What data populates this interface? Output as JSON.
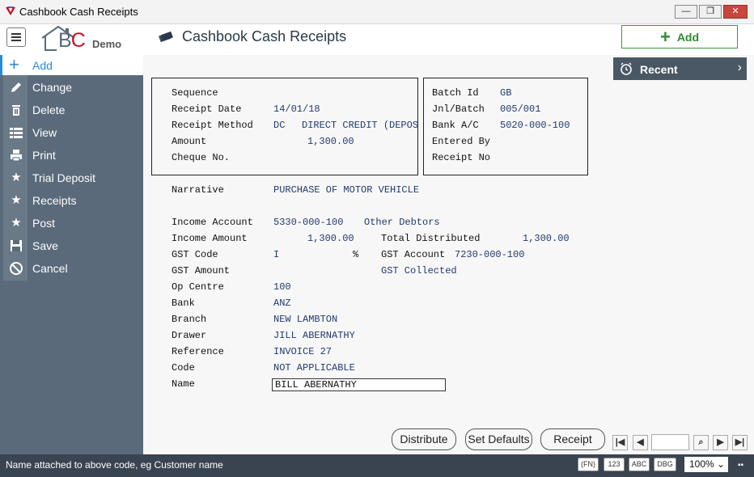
{
  "window": {
    "title": "Cashbook Cash Receipts",
    "min": "—",
    "restore": "❐",
    "close": "✕"
  },
  "header": {
    "logo_b": "B",
    "logo_c": "C",
    "logo_demo": "Demo",
    "page_title": "Cashbook Cash Receipts",
    "add_label": "Add",
    "plus": "+"
  },
  "sidebar": {
    "add": "Add",
    "items": [
      {
        "label": "Change",
        "icon": "pencil-icon"
      },
      {
        "label": "Delete",
        "icon": "trash-icon"
      },
      {
        "label": "View",
        "icon": "list-icon"
      },
      {
        "label": "Print",
        "icon": "printer-icon"
      },
      {
        "label": "Trial Deposit",
        "icon": "star-icon"
      },
      {
        "label": "Receipts",
        "icon": "star-icon"
      },
      {
        "label": "Post",
        "icon": "star-icon"
      },
      {
        "label": "Save",
        "icon": "floppy-icon"
      },
      {
        "label": "Cancel",
        "icon": "cancel-icon"
      }
    ]
  },
  "recent": {
    "label": "Recent",
    "chevron": "›"
  },
  "form": {
    "sequence_label": "Sequence",
    "receipt_date_label": "Receipt Date",
    "receipt_date": "14/01/18",
    "receipt_method_label": "Receipt Method",
    "receipt_method_code": "DC",
    "receipt_method_desc": "DIRECT CREDIT (DEPOS",
    "amount_label": "Amount",
    "amount": "1,300.00",
    "cheque_label": "Cheque No.",
    "batch_id_label": "Batch Id",
    "batch_id": "GB",
    "jnl_batch_label": "Jnl/Batch",
    "jnl_batch": "005/001",
    "bank_ac_label": "Bank A/C",
    "bank_ac": "5020-000-100",
    "entered_by_label": "Entered By",
    "receipt_no_label": "Receipt No",
    "narrative_label": "Narrative",
    "narrative": "PURCHASE OF MOTOR VEHICLE",
    "income_account_label": "Income Account",
    "income_account": "5330-000-100",
    "income_account_desc": "Other Debtors",
    "income_amount_label": "Income Amount",
    "income_amount": "1,300.00",
    "total_distributed_label": "Total Distributed",
    "total_distributed": "1,300.00",
    "gst_code_label": "GST Code",
    "gst_code": "I",
    "gst_pct": "%",
    "gst_account_label": "GST Account",
    "gst_account": "7230-000-100",
    "gst_amount_label": "GST Amount",
    "gst_collected": "GST Collected",
    "op_centre_label": "Op Centre",
    "op_centre": "100",
    "bank_label": "Bank",
    "bank": "ANZ",
    "branch_label": "Branch",
    "branch": "NEW LAMBTON",
    "drawer_label": "Drawer",
    "drawer": "JILL ABERNATHY",
    "reference_label": "Reference",
    "reference": "INVOICE 27",
    "code_label": "Code",
    "code": "NOT APPLICABLE",
    "name_label": "Name",
    "name": "BILL ABERNATHY"
  },
  "buttons": {
    "distribute": "Distribute",
    "set_defaults": "Set Defaults",
    "receipt": "Receipt"
  },
  "nav": {
    "first": "|◀",
    "prev": "◀",
    "search": "⌕",
    "next": "▶",
    "last": "▶|"
  },
  "status": {
    "message": "Name attached to above code, eg Customer name",
    "fn": "(FN)",
    "num": "123",
    "abc": "ABC",
    "dbg": "DBG",
    "zoom": "100% ⌄",
    "grip": "▪▪"
  }
}
